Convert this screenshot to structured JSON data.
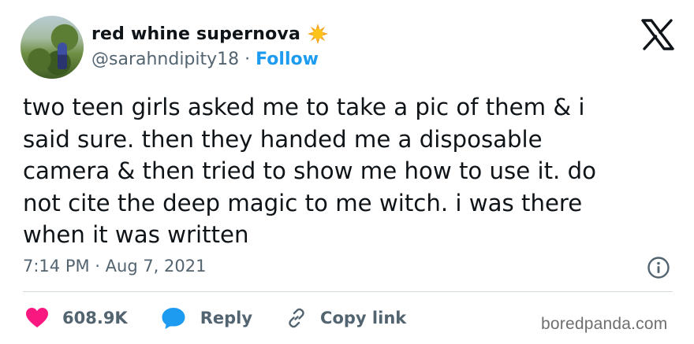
{
  "author": {
    "display_name": "red whine supernova",
    "handle": "@sarahndipity18",
    "separator": "·",
    "follow_label": "Follow",
    "badge_icon": "sun-emoji-icon"
  },
  "tweet": {
    "text": "two teen girls asked me to take a pic of them & i\nsaid sure. then they handed me a disposable\ncamera & then tried to show me how to use it. do\nnot cite the deep magic to me witch. i was there\nwhen it was written",
    "timestamp": "7:14 PM · Aug 7, 2021"
  },
  "actions": {
    "like_count": "608.9K",
    "reply_label": "Reply",
    "copy_link_label": "Copy link"
  },
  "watermark": "boredpanda.com",
  "colors": {
    "accent": "#1d9bf0",
    "like": "#f91880",
    "text": "#0f1419",
    "muted": "#536471"
  }
}
